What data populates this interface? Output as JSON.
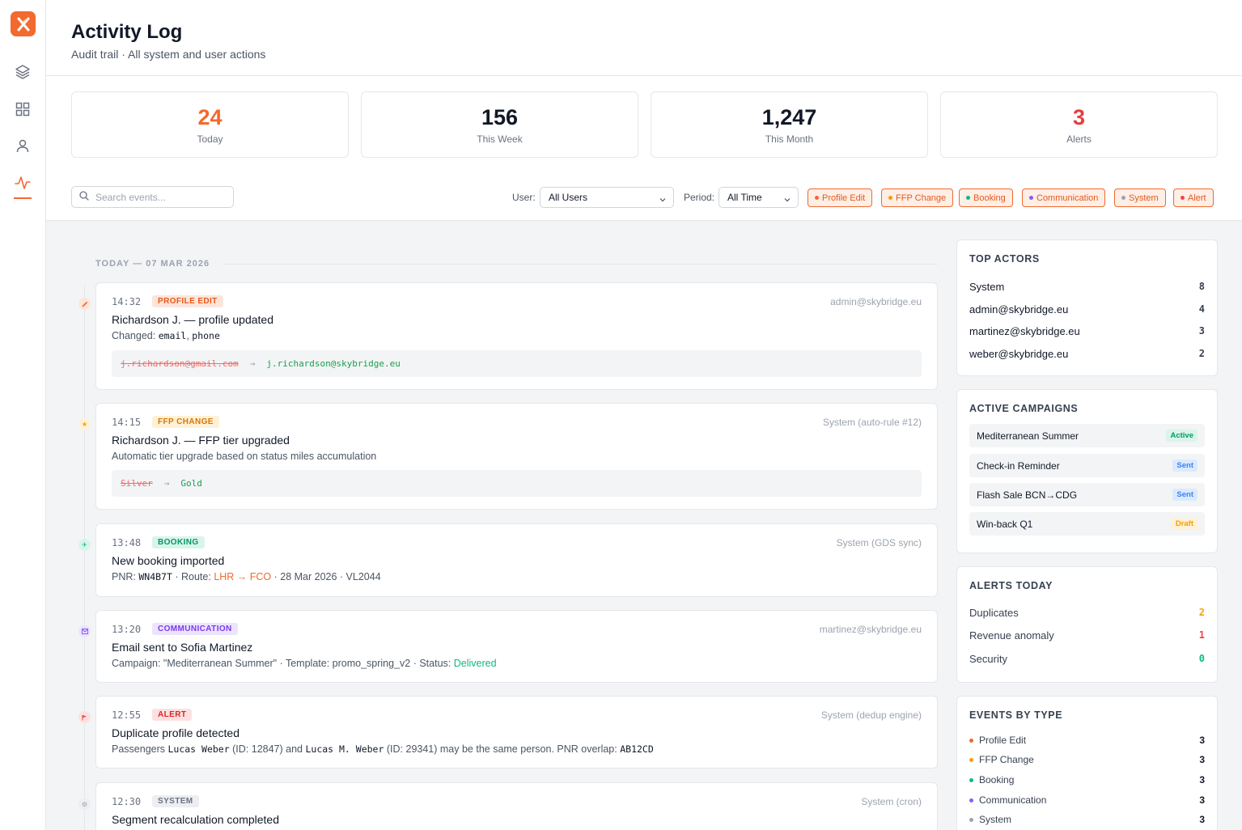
{
  "app": {
    "logo_icon": "x-logo-icon",
    "accent": "#f26a2e"
  },
  "sidebar": {
    "items": [
      {
        "icon": "layers-icon"
      },
      {
        "icon": "grid-icon"
      },
      {
        "icon": "user-icon"
      },
      {
        "icon": "activity-icon",
        "active": true
      }
    ]
  },
  "header": {
    "title": "Activity Log",
    "subtitle": "Audit trail · All system and user actions"
  },
  "stats": [
    {
      "value": "24",
      "label": "Today",
      "color": "#f26a2e"
    },
    {
      "value": "156",
      "label": "This Week",
      "color": "#111827"
    },
    {
      "value": "1,247",
      "label": "This Month",
      "color": "#111827"
    },
    {
      "value": "3",
      "label": "Alerts",
      "color": "#e53e3e"
    }
  ],
  "filters": {
    "search_placeholder": "Search events...",
    "user_label": "User:",
    "user_value": "All Users",
    "period_label": "Period:",
    "period_value": "All Time",
    "chips": [
      {
        "label": "Profile Edit",
        "dot": "#f26a2e"
      },
      {
        "label": "FFP Change",
        "dot": "#f59e0b"
      },
      {
        "label": "Booking",
        "dot": "#10b981"
      },
      {
        "label": "Communication",
        "dot": "#8b5cf6"
      },
      {
        "label": "System",
        "dot": "#9ca3af"
      },
      {
        "label": "Alert",
        "dot": "#ef4444"
      }
    ]
  },
  "timeline": {
    "day_label": "TODAY — 07 MAR 2026",
    "events": [
      {
        "time": "14:32",
        "type": "PROFILE EDIT",
        "actor": "admin@skybridge.eu",
        "title": "Richardson J. — profile updated",
        "desc_prefix": "Changed: ",
        "desc_code1": "email",
        "desc_sep": ", ",
        "desc_code2": "phone",
        "diff_old": "j.richardson@gmail.com",
        "diff_arrow": "→",
        "diff_new": "j.richardson@skybridge.eu"
      },
      {
        "time": "14:15",
        "type": "FFP CHANGE",
        "actor": "System (auto-rule #12)",
        "title": "Richardson J. — FFP tier upgraded",
        "desc": "Automatic tier upgrade based on status miles accumulation",
        "diff_old": "Silver",
        "diff_arrow": "→",
        "diff_new": "Gold"
      },
      {
        "time": "13:48",
        "type": "BOOKING",
        "actor": "System (GDS sync)",
        "title": "New booking imported",
        "pnr_label": "PNR: ",
        "pnr": "WN4B7T",
        "route_label": " · Route: ",
        "route": "LHR → FCO",
        "desc_rest": " · 28 Mar 2026 · VL2044"
      },
      {
        "time": "13:20",
        "type": "COMMUNICATION",
        "actor": "martinez@skybridge.eu",
        "title": "Email sent to Sofia Martinez",
        "desc": "Campaign: \"Mediterranean Summer\" · Template: promo_spring_v2 · Status: ",
        "status": "Delivered"
      },
      {
        "time": "12:55",
        "type": "ALERT",
        "actor": "System (dedup engine)",
        "title": "Duplicate profile detected",
        "p1": "Passengers ",
        "n1": "Lucas Weber",
        "p2": " (ID: 12847) and ",
        "n2": "Lucas M. Weber",
        "p3": " (ID: 29341) may be the same person. PNR overlap: ",
        "pnr": "AB12CD"
      },
      {
        "time": "12:30",
        "type": "SYSTEM",
        "actor": "System (cron)",
        "title": "Segment recalculation completed"
      }
    ]
  },
  "top_actors": {
    "title": "TOP ACTORS",
    "rows": [
      {
        "name": "System",
        "count": "8"
      },
      {
        "name": "admin@skybridge.eu",
        "count": "4"
      },
      {
        "name": "martinez@skybridge.eu",
        "count": "3"
      },
      {
        "name": "weber@skybridge.eu",
        "count": "2"
      }
    ]
  },
  "campaigns": {
    "title": "ACTIVE CAMPAIGNS",
    "rows": [
      {
        "name": "Mediterranean Summer",
        "status": "Active"
      },
      {
        "name": "Check-in Reminder",
        "status": "Sent"
      },
      {
        "name": "Flash Sale BCN→CDG",
        "status": "Sent"
      },
      {
        "name": "Win-back Q1",
        "status": "Draft"
      }
    ]
  },
  "alerts_today": {
    "title": "ALERTS TODAY",
    "rows": [
      {
        "name": "Duplicates",
        "count": "2",
        "color": "#f59e0b"
      },
      {
        "name": "Revenue anomaly",
        "count": "1",
        "color": "#ef4444"
      },
      {
        "name": "Security",
        "count": "0",
        "color": "#10b981"
      }
    ]
  },
  "events_by_type": {
    "title": "EVENTS BY TYPE",
    "rows": [
      {
        "name": "Profile Edit",
        "count": "3",
        "dot": "#f26a2e"
      },
      {
        "name": "FFP Change",
        "count": "3",
        "dot": "#f59e0b"
      },
      {
        "name": "Booking",
        "count": "3",
        "dot": "#10b981"
      },
      {
        "name": "Communication",
        "count": "3",
        "dot": "#8b5cf6"
      },
      {
        "name": "System",
        "count": "3",
        "dot": "#9ca3af"
      }
    ]
  }
}
